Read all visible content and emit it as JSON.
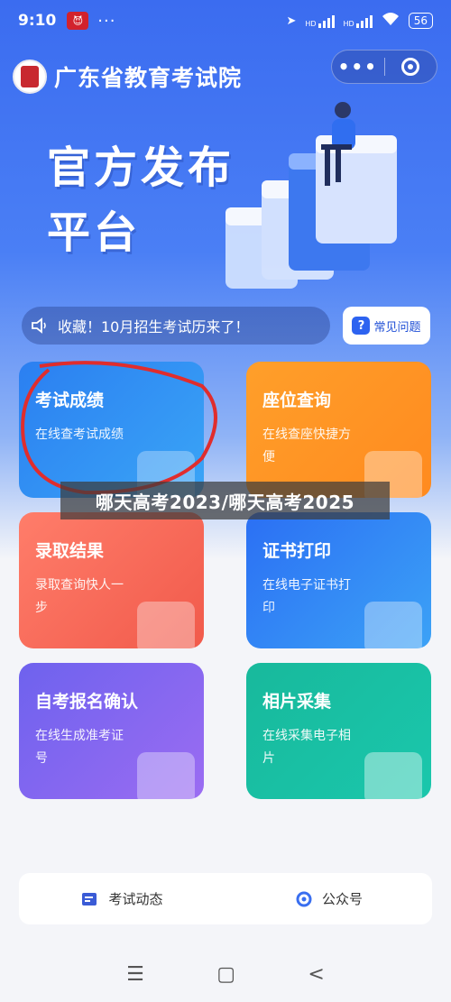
{
  "status_bar": {
    "time": "9:10",
    "app_badge": "😈",
    "more_dots": "···",
    "signal_labels": [
      "HD",
      "HD"
    ],
    "battery": "56"
  },
  "header": {
    "org_name": "广东省教育考试院",
    "menu_dots": "•••"
  },
  "banner": {
    "title_line1": "官方发布",
    "title_line2": "平台"
  },
  "notice": {
    "text": "收藏！10月招生考试历来了！"
  },
  "faq_button": {
    "label": "常见问题",
    "icon_glyph": "?"
  },
  "cards": [
    {
      "title": "考试成绩",
      "desc": "在线查考试成绩",
      "color": "#2b7ff1"
    },
    {
      "title": "座位查询",
      "desc": "在线查座快捷方便",
      "color": "#ff9f2a"
    },
    {
      "title": "录取结果",
      "desc": "录取查询快人一步",
      "color": "#f15a4b"
    },
    {
      "title": "证书打印",
      "desc": "在线电子证书打印",
      "color": "#2b6ff4"
    },
    {
      "title": "自考报名确认",
      "desc": "在线生成准考证号",
      "color": "#7d64ef"
    },
    {
      "title": "相片采集",
      "desc": "在线采集电子相片",
      "color": "#18b99c"
    }
  ],
  "overlay_title": "哪天高考2023/哪天高考2025",
  "bottom_bar": {
    "news_label": "考试动态",
    "official_account_label": "公众号"
  },
  "nav_bar": {
    "menu": "☰",
    "home": "▢",
    "back": "<"
  }
}
